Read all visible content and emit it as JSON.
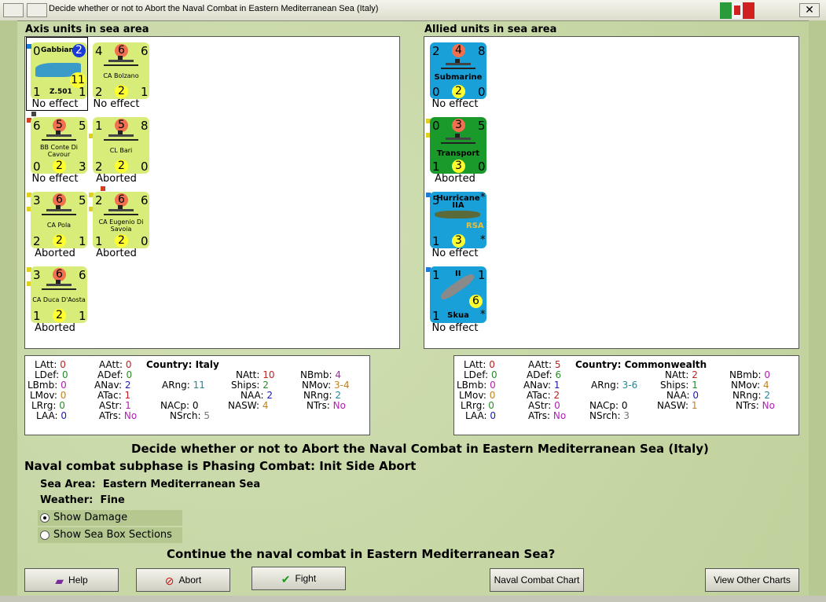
{
  "window": {
    "title": "Decide whether or not to Abort the Naval Combat in Eastern Mediterranean Sea (Italy)"
  },
  "axis": {
    "heading": "Axis units in sea area",
    "units": [
      {
        "name": "Gabbiano",
        "sub": "Z.501",
        "tl": "0",
        "tc": "2",
        "tr": "",
        "bl": "1",
        "bc": "11",
        "br": "1",
        "status": "No effect"
      },
      {
        "name": "CA Bolzano",
        "tl": "4",
        "tc": "6",
        "tr": "6",
        "bl": "2",
        "bc": "2",
        "br": "1",
        "status": "No effect"
      },
      {
        "name": "BB Conte Di Cavour",
        "tl": "6",
        "tc": "5",
        "tr": "5",
        "bl": "0",
        "bc": "2",
        "br": "3",
        "status": "No effect"
      },
      {
        "name": "CL Bari",
        "tl": "1",
        "tc": "5",
        "tr": "8",
        "bl": "2",
        "bc": "2",
        "br": "0",
        "status": "Aborted"
      },
      {
        "name": "CA Pola",
        "tl": "3",
        "tc": "6",
        "tr": "5",
        "bl": "2",
        "bc": "2",
        "br": "1",
        "status": "Aborted"
      },
      {
        "name": "CA Eugenio Di Savoia",
        "tl": "2",
        "tc": "6",
        "tr": "6",
        "bl": "1",
        "bc": "2",
        "br": "0",
        "status": "Aborted"
      },
      {
        "name": "CA Duca D'Aosta",
        "tl": "3",
        "tc": "6",
        "tr": "6",
        "bl": "1",
        "bc": "2",
        "br": "1",
        "status": "Aborted"
      }
    ]
  },
  "allied": {
    "heading": "Allied units in sea area",
    "units": [
      {
        "name": "Submarine",
        "tl": "2",
        "tc": "4",
        "tr": "8",
        "bl": "0",
        "bc": "2",
        "br": "0",
        "status": "No effect"
      },
      {
        "name": "Transport",
        "tl": "0",
        "tc": "3",
        "tr": "5",
        "bl": "1",
        "bc": "3",
        "br": "0",
        "status": "Aborted"
      },
      {
        "name": "Hurricane IIA",
        "sub": "RSA",
        "tl": "5",
        "tr": "*",
        "bl": "1",
        "bc": "3",
        "br": "*",
        "status": "No effect"
      },
      {
        "name": "Skua",
        "tl": "1",
        "tc": "II",
        "tr": "1",
        "bl": "1",
        "bc": "6",
        "br": "*",
        "status": "No effect"
      }
    ]
  },
  "axis_stats": {
    "country_label": "Country:",
    "country": "Italy",
    "LAtt": "0",
    "LDef": "0",
    "LBmb": "0",
    "LMov": "0",
    "LRrg": "0",
    "LAA": "0",
    "AAtt": "0",
    "ADef": "0",
    "ANav": "2",
    "ATac": "1",
    "AStr": "1",
    "ATrs": "No",
    "ARng": "11",
    "NACp": "0",
    "NSrch": "5",
    "NAtt": "10",
    "Ships": "2",
    "NAA": "2",
    "NASW": "4",
    "NBmb": "4",
    "NMov": "3-4",
    "NRng": "2",
    "NTrs": "No"
  },
  "allied_stats": {
    "country_label": "Country:",
    "country": "Commonwealth",
    "LAtt": "0",
    "LDef": "0",
    "LBmb": "0",
    "LMov": "0",
    "LRrg": "0",
    "LAA": "0",
    "AAtt": "5",
    "ADef": "6",
    "ANav": "1",
    "ATac": "2",
    "AStr": "0",
    "ATrs": "No",
    "ARng": "3-6",
    "NACp": "0",
    "NSrch": "3",
    "NAtt": "2",
    "Ships": "1",
    "NAA": "0",
    "NASW": "1",
    "NBmb": "0",
    "NMov": "4",
    "NRng": "2",
    "NTrs": "No"
  },
  "labels": {
    "LAtt": "LAtt:",
    "LDef": "LDef:",
    "LBmb": "LBmb:",
    "LMov": "LMov:",
    "LRrg": "LRrg:",
    "LAA": "LAA:",
    "AAtt": "AAtt:",
    "ADef": "ADef:",
    "ANav": "ANav:",
    "ATac": "ATac:",
    "AStr": "AStr:",
    "ATrs": "ATrs:",
    "ARng": "ARng:",
    "NACp": "NACp:",
    "NSrch": "NSrch:",
    "NAtt": "NAtt:",
    "Ships": "Ships:",
    "NAA": "NAA:",
    "NASW": "NASW:",
    "NBmb": "NBmb:",
    "NMov": "NMov:",
    "NRng": "NRng:",
    "NTrs": "NTrs:"
  },
  "info": {
    "headline": "Decide whether or not to Abort the Naval Combat in Eastern Mediterranean Sea (Italy)",
    "subphase": "Naval combat subphase is Phasing Combat: Init Side Abort",
    "sea_area_label": "Sea Area:",
    "sea_area": "Eastern Mediterranean Sea",
    "weather_label": "Weather:",
    "weather": "Fine",
    "opt1": "Show Damage",
    "opt2": "Show Sea Box Sections",
    "question": "Continue the naval combat in Eastern Mediterranean Sea?"
  },
  "buttons": {
    "help": "Help",
    "abort": "Abort",
    "fight": "Fight",
    "naval_chart": "Naval Combat Chart",
    "other_charts": "View Other Charts"
  },
  "colors": {
    "axis_counter": "#d8ec7a",
    "allied_counter": "#1aa0d8",
    "transport_counter": "#1a9a2a",
    "circle_red": "#f07050",
    "circle_yellow": "#ffff30"
  }
}
